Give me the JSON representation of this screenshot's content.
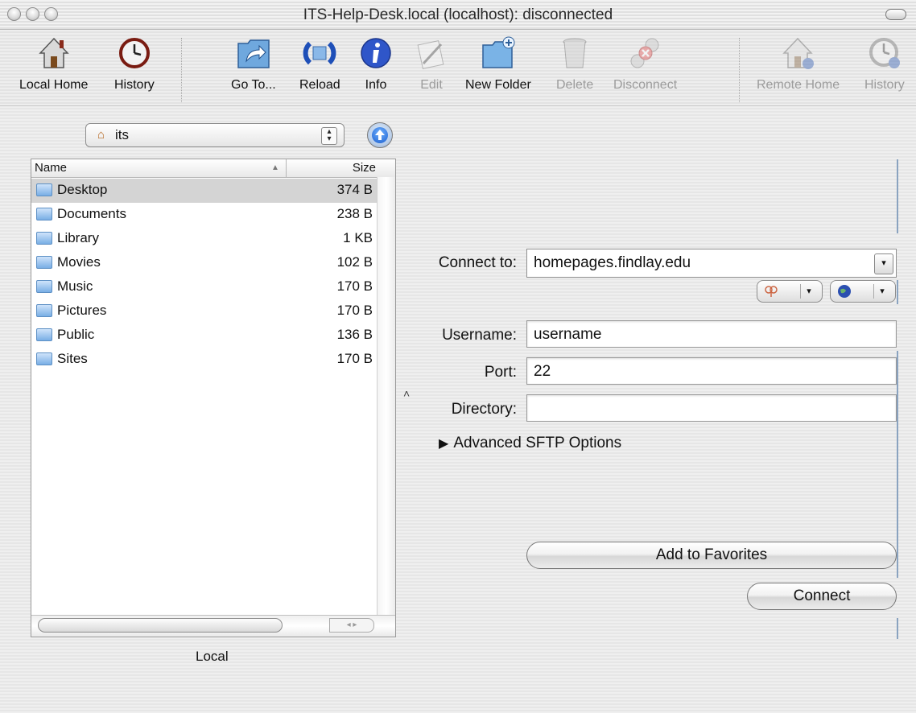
{
  "window": {
    "title": "ITS-Help-Desk.local (localhost): disconnected"
  },
  "toolbar": {
    "local_home": "Local Home",
    "history_left": "History",
    "goto": "Go To...",
    "reload": "Reload",
    "info": "Info",
    "edit": "Edit",
    "new_folder": "New Folder",
    "delete": "Delete",
    "disconnect": "Disconnect",
    "remote_home": "Remote Home",
    "history_right": "History"
  },
  "local": {
    "path": "its",
    "columns": {
      "name": "Name",
      "size": "Size"
    },
    "files": [
      {
        "name": "Desktop",
        "size": "374 B",
        "selected": true
      },
      {
        "name": "Documents",
        "size": "238 B"
      },
      {
        "name": "Library",
        "size": "1 KB"
      },
      {
        "name": "Movies",
        "size": "102 B"
      },
      {
        "name": "Music",
        "size": "170 B"
      },
      {
        "name": "Pictures",
        "size": "170 B"
      },
      {
        "name": "Public",
        "size": "136 B"
      },
      {
        "name": "Sites",
        "size": "170 B"
      }
    ],
    "pane_label": "Local"
  },
  "connection": {
    "connect_to_label": "Connect to:",
    "connect_to_value": "homepages.findlay.edu",
    "username_label": "Username:",
    "username_value": "username",
    "port_label": "Port:",
    "port_value": "22",
    "directory_label": "Directory:",
    "directory_value": "",
    "advanced_label": "Advanced SFTP Options",
    "add_favorites": "Add to Favorites",
    "connect": "Connect"
  },
  "colors": {
    "selection": "#d4d4d4",
    "folder_blue": "#79aee5",
    "info_blue": "#2f56c9"
  }
}
